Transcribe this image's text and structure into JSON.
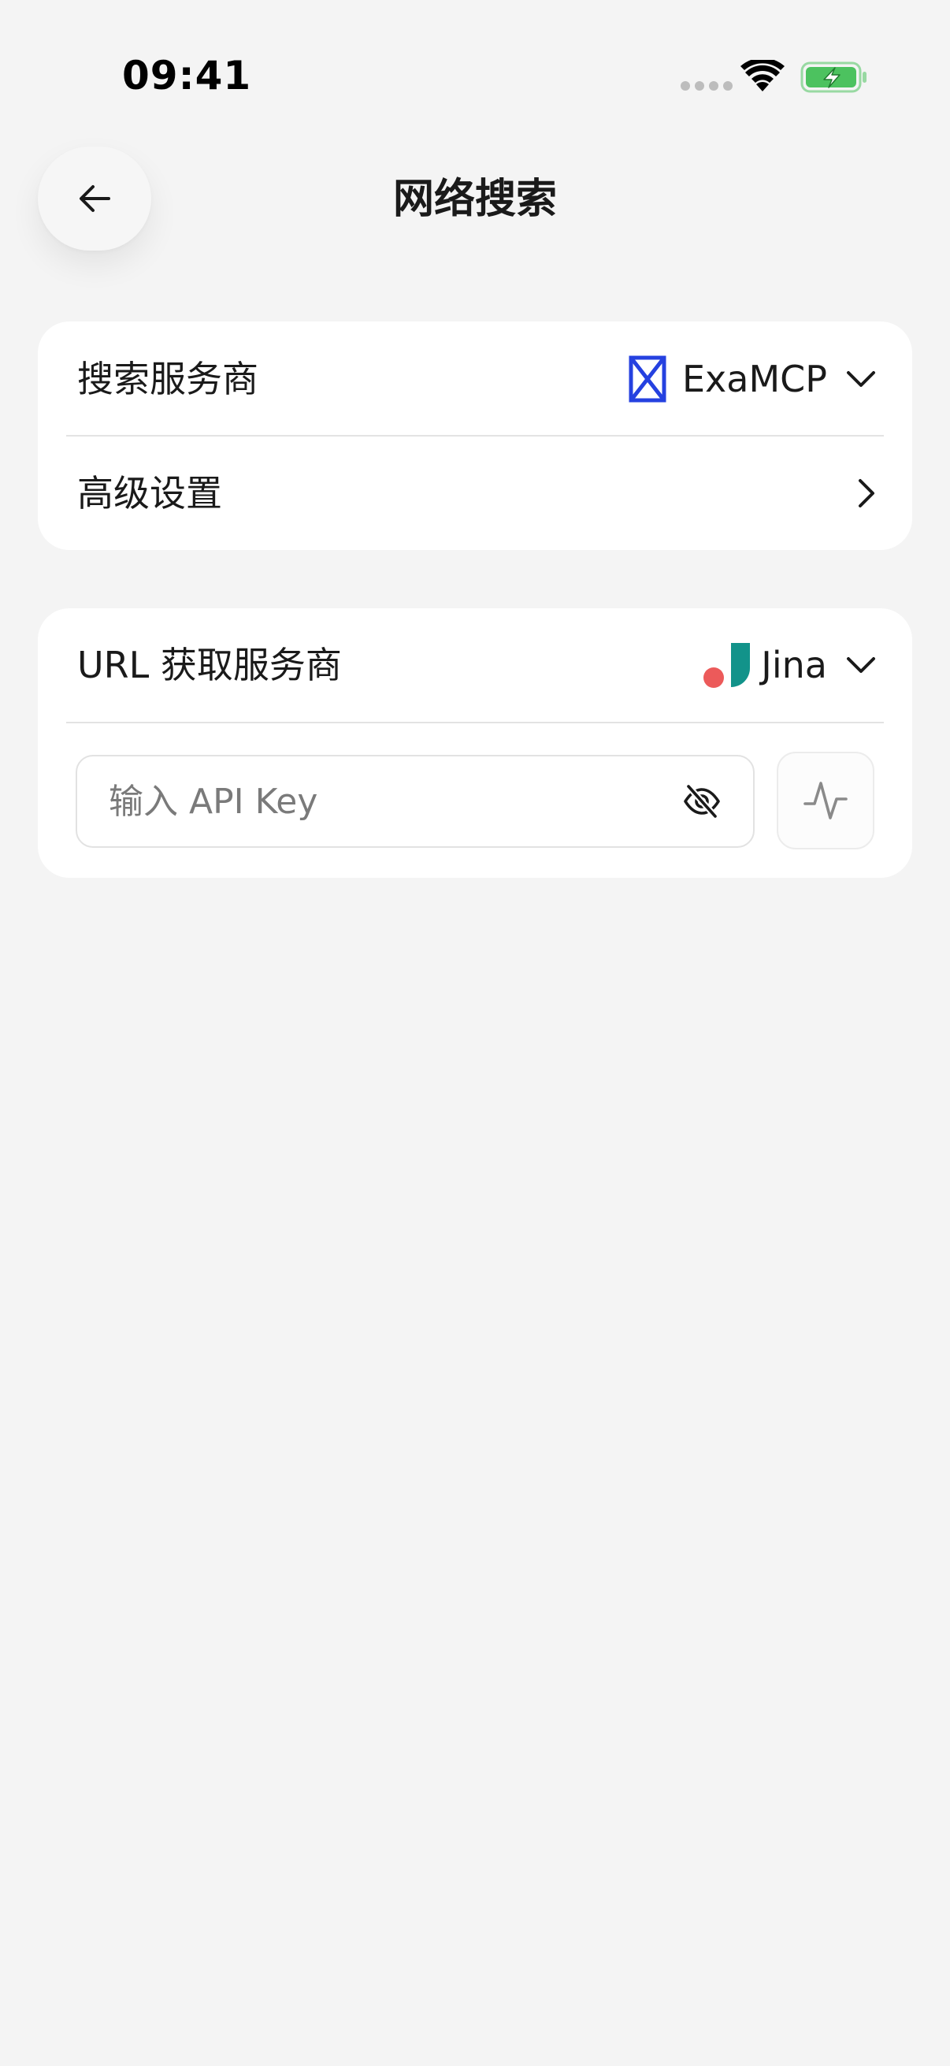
{
  "status_bar": {
    "time": "09:41"
  },
  "header": {
    "title": "网络搜索",
    "back_icon": "arrow-left-icon"
  },
  "search_card": {
    "provider_row": {
      "label": "搜索服务商",
      "selected_provider": "ExaMCP",
      "provider_icon": "exa-logo-icon",
      "brand_color": "#2541e0"
    },
    "advanced_row": {
      "label": "高级设置"
    }
  },
  "url_card": {
    "provider_row": {
      "label": "URL 获取服务商",
      "selected_provider": "Jina",
      "provider_icon": "jina-logo-icon",
      "brand_colors": [
        "#ec5a5a",
        "#12938a"
      ]
    },
    "api_key": {
      "value": "",
      "placeholder": "输入 API Key"
    },
    "test_button_icon": "activity-pulse-icon"
  }
}
